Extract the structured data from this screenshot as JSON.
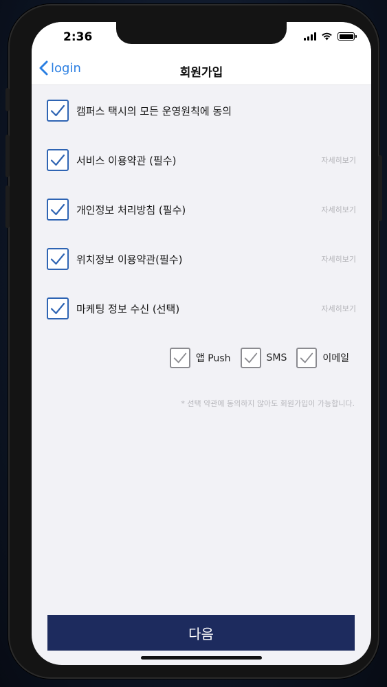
{
  "status": {
    "time": "2:36"
  },
  "nav": {
    "back_label": "login",
    "title": "회원가입"
  },
  "agreements": [
    {
      "label": "캠퍼스 택시의 모든 운영원칙에 동의",
      "checked": true,
      "detail": ""
    },
    {
      "label": "서비스 이용약관 (필수)",
      "checked": true,
      "detail": "자세히보기"
    },
    {
      "label": "개인정보 처리방침 (필수)",
      "checked": true,
      "detail": "자세히보기"
    },
    {
      "label": "위치정보 이용약관(필수)",
      "checked": true,
      "detail": "자세히보기"
    },
    {
      "label": "마케팅 정보 수신 (선택)",
      "checked": true,
      "detail": "자세히보기"
    }
  ],
  "marketing_channels": [
    {
      "label": "앱 Push",
      "checked": true
    },
    {
      "label": "SMS",
      "checked": true
    },
    {
      "label": "이메일",
      "checked": true
    }
  ],
  "notice": "* 선택 약관에 동의하지 않아도 회원가입이 가능합니다.",
  "next_button": "다음",
  "colors": {
    "accent": "#2e64b3",
    "button": "#1d2b5e",
    "link": "#2b7fe2",
    "background": "#f2f2f6"
  },
  "icons": {
    "back": "chevron-left-icon",
    "check": "checkmark-icon",
    "signal": "cellular-signal-icon",
    "wifi": "wifi-icon",
    "battery": "battery-icon"
  }
}
